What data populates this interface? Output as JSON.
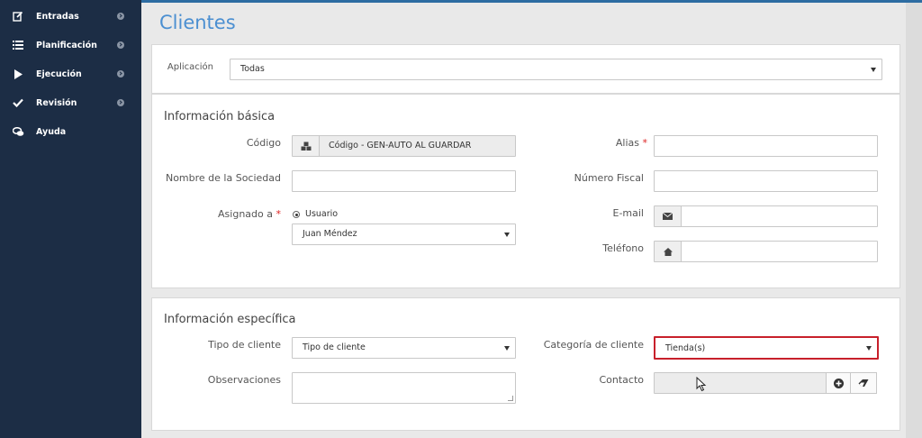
{
  "sidebar": {
    "items": [
      {
        "label": "Entradas",
        "icon": "edit-icon"
      },
      {
        "label": "Planificación",
        "icon": "list-icon"
      },
      {
        "label": "Ejecución",
        "icon": "play-icon"
      },
      {
        "label": "Revisión",
        "icon": "check-icon"
      },
      {
        "label": "Ayuda",
        "icon": "chat-icon"
      }
    ]
  },
  "page": {
    "title": "Clientes"
  },
  "aplicacion": {
    "label": "Aplicación",
    "value": "Todas"
  },
  "basic": {
    "title": "Información básica",
    "codigo_label": "Código",
    "codigo_value": "Código - GEN-AUTO AL GUARDAR",
    "sociedad_label": "Nombre de la Sociedad",
    "asignado_label": "Asignado a",
    "required_mark": "*",
    "radio_label": "Usuario",
    "asignado_value": "Juan Méndez",
    "alias_label": "Alias",
    "fiscal_label": "Número Fiscal",
    "email_label": "E-mail",
    "telefono_label": "Teléfono"
  },
  "specific": {
    "title": "Información específica",
    "tipo_label": "Tipo de cliente",
    "tipo_value": "Tipo de cliente",
    "obs_label": "Observaciones",
    "categoria_label": "Categoría de cliente",
    "categoria_value": "Tienda(s)",
    "contacto_label": "Contacto"
  },
  "colors": {
    "sidebar": "#1c2d45",
    "accent": "#4b8fd1",
    "highlight": "#c8202b"
  }
}
